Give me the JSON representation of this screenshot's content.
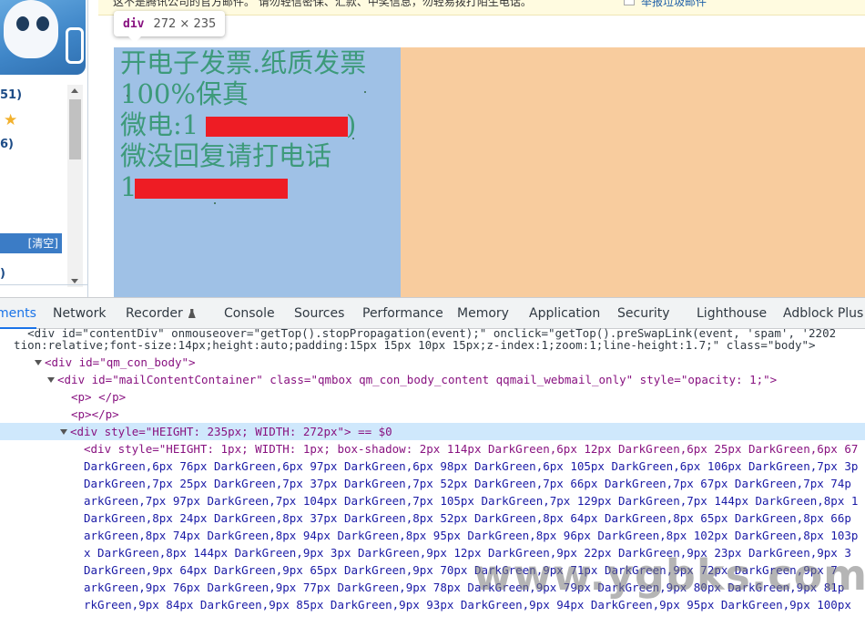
{
  "notice": {
    "text": "这不是腾讯公司的官方邮件。  请勿轻信密保、汇款、中奖信息，勿轻易拨打陌生电话。",
    "report_link": "举报垃圾邮件"
  },
  "sidebar": {
    "items": [
      {
        "label": "51)"
      },
      {
        "label": "★"
      },
      {
        "label": "6)"
      },
      {
        "label": "[清空]"
      },
      {
        "label": ")"
      }
    ]
  },
  "tooltip": {
    "tag": "div",
    "size": "272 × 235"
  },
  "email_body": {
    "lines": [
      "开电子发票.纸质发票",
      "100%保真",
      "微电:1",
      "微没回复请打电话",
      "1"
    ],
    "line_3_suffix": ")"
  },
  "devtools": {
    "tabs": [
      {
        "label": "ments"
      },
      {
        "label": "Network"
      },
      {
        "label": "Recorder"
      },
      {
        "label": "Console"
      },
      {
        "label": "Sources"
      },
      {
        "label": "Performance"
      },
      {
        "label": "Memory"
      },
      {
        "label": "Application"
      },
      {
        "label": "Security"
      },
      {
        "label": "Lighthouse"
      },
      {
        "label": "Adblock Plus"
      }
    ],
    "code": [
      "    <div id=\"contentDiv\" onmouseover=\"getTop().stopPropagation(event);\" onclick=\"getTop().preSwapLink(event, 'spam', '2202",
      "  tion:relative;font-size:14px;height:auto;padding:15px 15px 10px 15px;z-index:1;zoom:1;line-height:1.7;\" class=\"body\">",
      "<div id=\"qm_con_body\">",
      "<div id=\"mailContentContainer\" class=\"qmbox qm_con_body_content qqmail_webmail_only\" style=\"opacity: 1;\">",
      "<p> </p>",
      "<p></p>",
      "<div style=\"HEIGHT: 235px; WIDTH: 272px\"> == $0",
      "<div style=\"HEIGHT: 1px; WIDTH: 1px; box-shadow: 2px 114px DarkGreen,6px 12px DarkGreen,6px 25px DarkGreen,6px 67",
      "DarkGreen,6px 76px DarkGreen,6px 97px DarkGreen,6px 98px DarkGreen,6px 105px DarkGreen,6px 106px DarkGreen,7px 3p",
      "DarkGreen,7px 25px DarkGreen,7px 37px DarkGreen,7px 52px DarkGreen,7px 66px DarkGreen,7px 67px DarkGreen,7px 74p",
      "arkGreen,7px 97px DarkGreen,7px 104px DarkGreen,7px 105px DarkGreen,7px 129px DarkGreen,7px 144px DarkGreen,8px 1",
      "DarkGreen,8px 24px DarkGreen,8px 37px DarkGreen,8px 52px DarkGreen,8px 64px DarkGreen,8px 65px DarkGreen,8px 66p",
      "arkGreen,8px 74px DarkGreen,8px 94px DarkGreen,8px 95px DarkGreen,8px 96px DarkGreen,8px 102px DarkGreen,8px 103p",
      "x DarkGreen,8px 144px DarkGreen,9px 3px DarkGreen,9px 12px DarkGreen,9px 22px DarkGreen,9px 23px DarkGreen,9px 3",
      "DarkGreen,9px 64px DarkGreen,9px 65px DarkGreen,9px 70px DarkGreen,9px 71px DarkGreen,9px 72px DarkGreen,9px 7",
      "arkGreen,9px 76px DarkGreen,9px 77px DarkGreen,9px 78px DarkGreen,9px 79px DarkGreen,9px 80px DarkGreen,9px 81p",
      "rkGreen,9px 84px DarkGreen,9px 85px DarkGreen,9px 93px DarkGreen,9px 94px DarkGreen,9px 95px DarkGreen,9px 100px"
    ]
  },
  "watermark": "www.ygbks.com",
  "colors": {
    "content_box": "#9fc1e6",
    "margin_box": "#f8cc9e",
    "ad_text": "#3d9a7a",
    "redaction": "#ee1c24",
    "selected_row": "#cfe8fc"
  }
}
